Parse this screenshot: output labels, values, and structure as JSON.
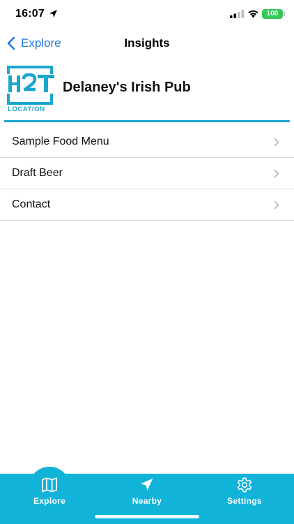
{
  "status_bar": {
    "time": "16:07",
    "battery": "100"
  },
  "nav": {
    "back_label": "Explore",
    "title": "Insights"
  },
  "header": {
    "logo_text": "LOCATION",
    "venue_name": "Delaney's Irish Pub"
  },
  "list": {
    "items": [
      {
        "label": "Sample Food Menu"
      },
      {
        "label": "Draft Beer"
      },
      {
        "label": "Contact"
      }
    ]
  },
  "tab_bar": {
    "tabs": [
      {
        "label": "Explore",
        "icon": "map-icon"
      },
      {
        "label": "Nearby",
        "icon": "navigation-arrow-icon"
      },
      {
        "label": "Settings",
        "icon": "gear-icon"
      }
    ]
  },
  "colors": {
    "accent": "#12b3d9",
    "link": "#1f7ae0",
    "battery": "#34c759"
  }
}
